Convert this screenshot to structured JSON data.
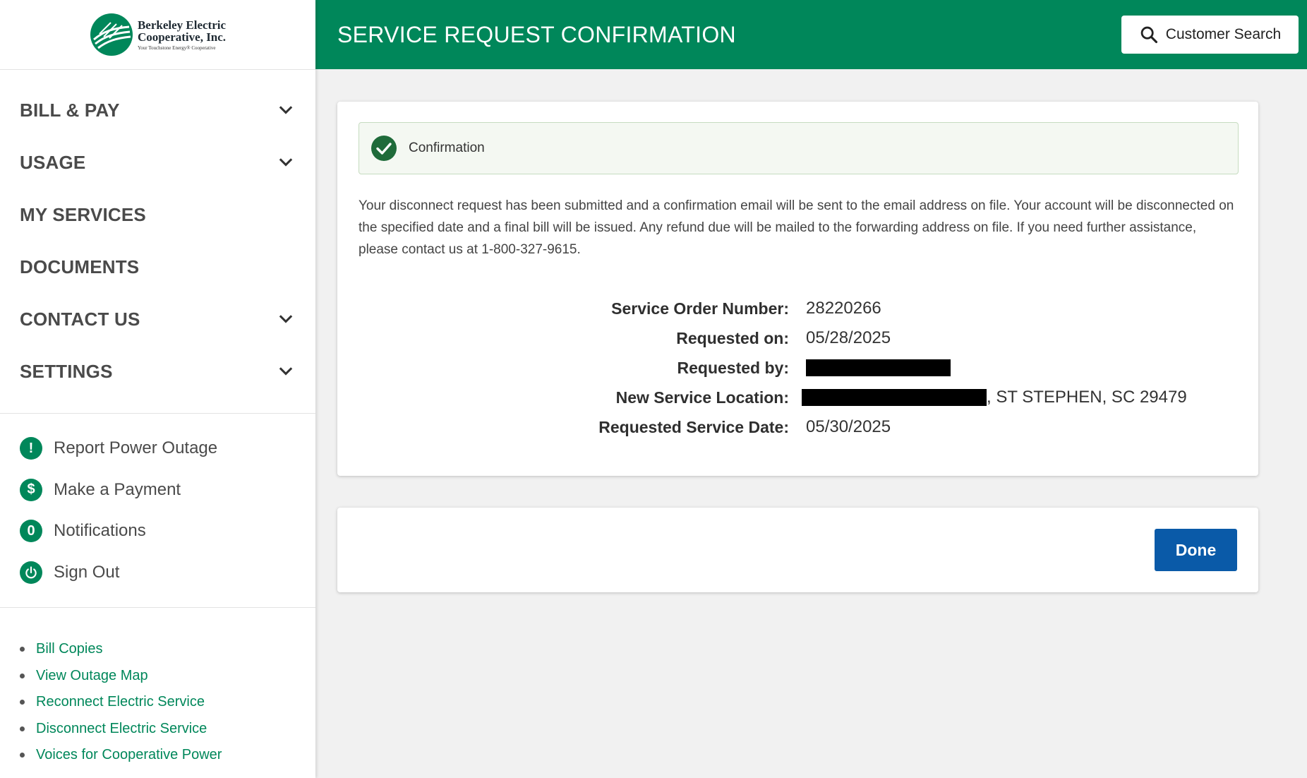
{
  "brand": {
    "line1": "Berkeley Electric",
    "line2": "Cooperative, Inc.",
    "tagline": "Your Touchstone Energy® Cooperative",
    "color": "#00875a"
  },
  "nav": {
    "items": [
      {
        "label": "BILL & PAY",
        "expandable": true
      },
      {
        "label": "USAGE",
        "expandable": true
      },
      {
        "label": "MY SERVICES",
        "expandable": false
      },
      {
        "label": "DOCUMENTS",
        "expandable": false
      },
      {
        "label": "CONTACT US",
        "expandable": true
      },
      {
        "label": "SETTINGS",
        "expandable": true
      }
    ]
  },
  "quick_actions": {
    "outage": {
      "icon": "!",
      "label": "Report Power Outage"
    },
    "payment": {
      "icon": "$",
      "label": "Make a Payment"
    },
    "notifications": {
      "icon": "0",
      "label": "Notifications"
    },
    "signout": {
      "label": "Sign Out"
    }
  },
  "links": [
    "Bill Copies",
    "View Outage Map",
    "Reconnect Electric Service",
    "Disconnect Electric Service",
    "Voices for Cooperative Power"
  ],
  "header": {
    "title": "SERVICE REQUEST CONFIRMATION",
    "search_label": "Customer Search"
  },
  "confirmation": {
    "alert_text": "Confirmation",
    "message": "Your disconnect request has been submitted and a confirmation email will be sent to the email address on file.  Your account will be disconnected on the specified date and a final bill will be issued.  Any refund due will be mailed to the forwarding address on file.  If you need further assistance, please contact us at 1-800-327-9615.",
    "details": {
      "order_label": "Service Order Number:",
      "order_value": "28220266",
      "requested_on_label": "Requested on:",
      "requested_on_value": "05/28/2025",
      "requested_by_label": "Requested by:",
      "location_label": "New Service Location:",
      "location_suffix": ", ST STEPHEN, SC 29479",
      "service_date_label": "Requested Service Date:",
      "service_date_value": "05/30/2025"
    }
  },
  "actions": {
    "done_label": "Done"
  }
}
